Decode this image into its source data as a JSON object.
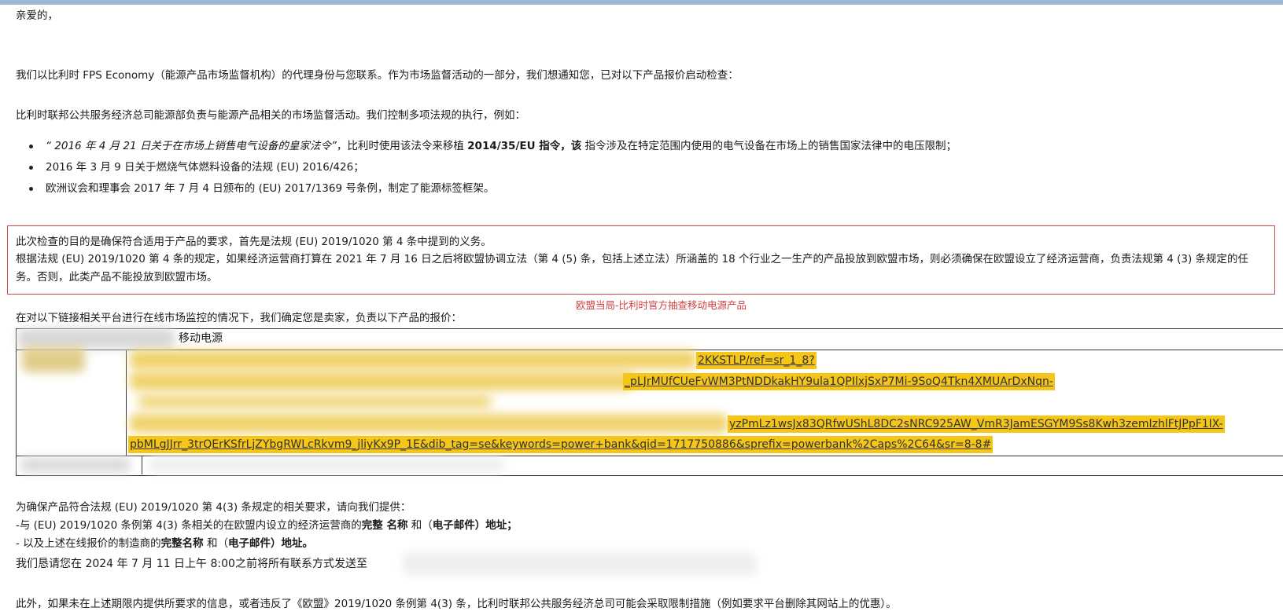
{
  "greeting": "亲爱的，",
  "intro": "我们以比利时 FPS Economy（能源产品市场监督机构）的代理身份与您联系。作为市场监督活动的一部分，我们想通知您，已对以下产品报价启动检查：",
  "para2": "比利时联邦公共服务经济总司能源部负责与能源产品相关的市场监督活动。我们控制多项法规的执行，例如：",
  "bullets": {
    "b1_quote": "“ 2016 年 4 月 21 日关于在市场上销售电气设备的皇家法令”",
    "b1_mid": "，比利时使用该法令来移植 ",
    "b1_bold": "2014/35/EU 指令，该",
    "b1_end": " 指令涉及在特定范围内使用的电气设备在市场上的销售国家法律中的电压限制；",
    "b2": "2016 年 3 月 9 日关于燃烧气体燃料设备的法规 (EU) 2016/426；",
    "b3": "欧洲议会和理事会 2017 年 7 月 4 日颁布的 (EU) 2017/1369 号条例，制定了能源标签框架。"
  },
  "box": {
    "line1": "此次检查的目的是确保符合适用于产品的要求，首先是法规 (EU) 2019/1020 第 4 条中提到的义务。",
    "line2": "根据法规 (EU) 2019/1020 第 4 条的规定，如果经济运营商打算在 2021 年 7 月 16 日之后将欧盟协调立法（第 4 (5) 条，包括上述立法）所涵盖的 18 个行业之一生产的产品投放到欧盟市场，则必须确保在欧盟设立了经济运营商，负责法规第 4 (3) 条规定的任",
    "line3": "务。否则，此类产品不能投放到欧盟市场。",
    "caption": "欧盟当局-比利时官方抽查移动电源产品"
  },
  "table_intro": "在对以下链接相关平台进行在线市场监控的情况下，我们确定您是卖家，负责以下产品的报价：",
  "table": {
    "product": "移动电源",
    "link_1": "2KKSTLP/ref=sr_1_8?",
    "link_2": "_pLJrMUfCUeFvWM3PtNDDkakHY9ula1QPIlxjSxP7Mi-9SoQ4Tkn4XMUArDxNqn-",
    "link_3": "yzPmLz1wsJx83QRfwUShL8DC2sNRC925AW_VmR3JamESGYM9Ss8Kwh3zemIzhlFtJPpF1IX-",
    "link_4": "pbMLgJJrr_3trQErKSfrLjZYbgRWLcRkvm9_jliyKx9P_1E&dib_tag=se&keywords=power+bank&qid=1717750886&sprefix=powerbank%2Caps%2C64&sr=8-8#"
  },
  "req": {
    "line1": "为确保产品符合法规 (EU) 2019/1020 第 4(3) 条规定的相关要求，请向我们提供：",
    "line2_a": "-与 (EU) 2019/1020 条例第 4(3) 条相关的在欧盟内设立的经济运营商的",
    "line2_b": "完整 名称",
    "line2_c": " 和（",
    "line2_d": "电子邮件）地址；",
    "line3_a": "- 以及上述在线报价的制造商的",
    "line3_b": "完整名称",
    "line3_c": " 和（",
    "line3_d": "电子邮件）地址。",
    "line4": "我们恳请您在 2024 年 7 月 11 日上午 8:00之前将所有联系方式发送至"
  },
  "footer": "此外，如果未在上述期限内提供所要求的信息，或者违反了《欧盟》2019/1020 条例第 4(3) 条，比利时联邦公共服务经济总司可能会采取限制措施（例如要求平台删除其网站上的优惠）。"
}
